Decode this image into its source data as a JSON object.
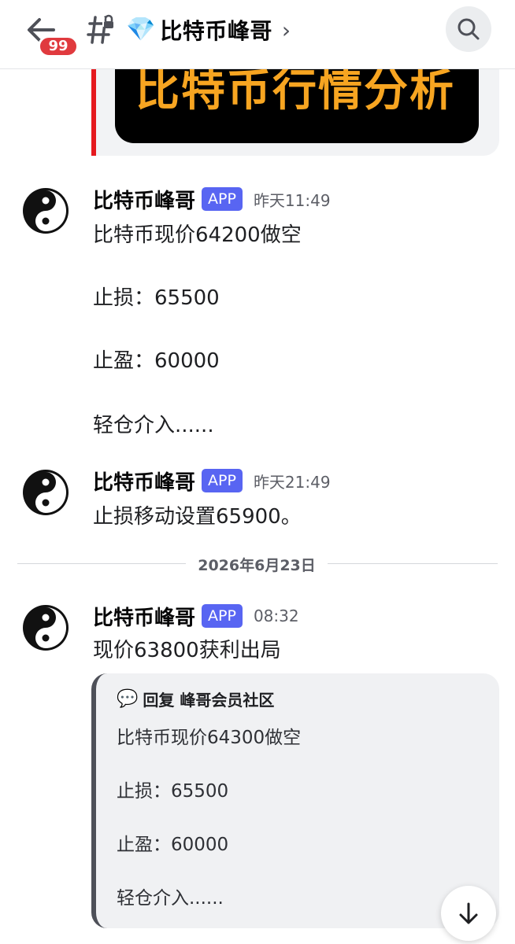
{
  "header": {
    "unread_count": "99",
    "channel_icon": "hashtag-lock-icon",
    "channel_gem": "💎",
    "channel_name": "比特币峰哥",
    "chevron": "›"
  },
  "top_embed": {
    "image_text": "比特币行情分析"
  },
  "messages": [
    {
      "author": "比特币峰哥",
      "badge": "APP",
      "timestamp": "昨天11:49",
      "lines": [
        "比特币现价64200做空",
        "止损：65500",
        "止盈：60000",
        "轻仓介入......"
      ]
    },
    {
      "author": "比特币峰哥",
      "badge": "APP",
      "timestamp": "昨天21:49",
      "lines": [
        "止损移动设置65900。"
      ]
    },
    {
      "author": "比特币峰哥",
      "badge": "APP",
      "timestamp": "08:32",
      "lines": [
        "现价63800获利出局"
      ]
    }
  ],
  "date_divider": "2026年6月23日",
  "reply_embed": {
    "icon": "💬",
    "title": "回复 峰哥会员社区",
    "lines": [
      "比特币现价64300做空",
      "止损：65500",
      "止盈：60000",
      "轻仓介入......"
    ]
  },
  "colors": {
    "app_badge": "#5865f2",
    "unread_badge": "#e03a3e",
    "embed_accent": "#e5191e",
    "embed_text": "#f7a521"
  }
}
